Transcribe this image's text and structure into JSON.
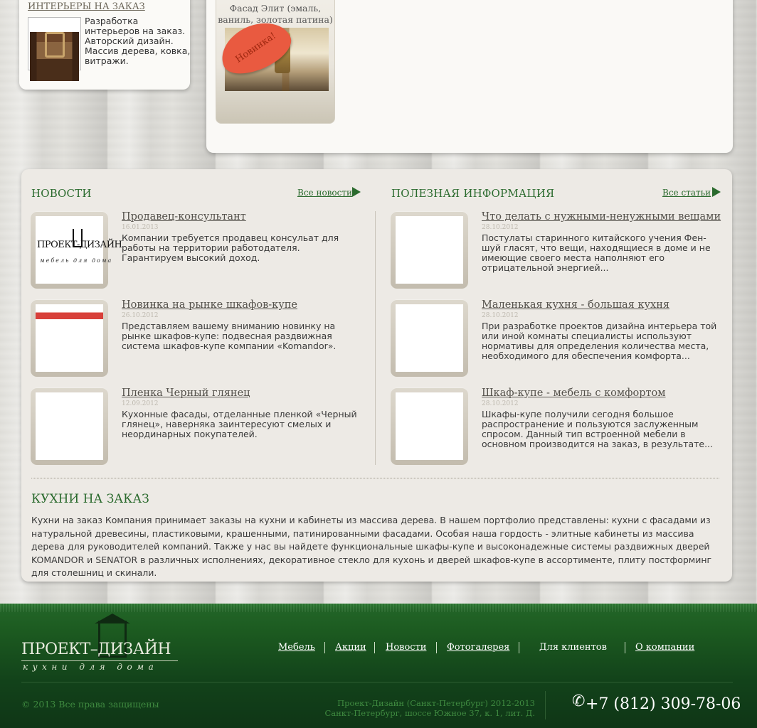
{
  "interiors_card": {
    "title": "ИНТЕРЬЕРЫ НА ЗАКАЗ",
    "description": "Разработка интерьеров на заказ. Авторский дизайн. Массив дерева, ковка, витражи."
  },
  "featured_product": {
    "name_line1": "Фасад Элит (эмаль,",
    "name_line2": "ваниль, золотая патина)",
    "badge": "Новинка!"
  },
  "news": {
    "title": "НОВОСТИ",
    "all_link": "Все новости",
    "items": [
      {
        "title": "Продавец-консультант",
        "date": "16.01.2013",
        "text": "Компании требуется продавец консульат для работы на территории работодателя. Гарантируем высокий доход.",
        "thumb_text": "ПРОЕКТ-ДИЗАЙН",
        "thumb_sub": "мебель для дома"
      },
      {
        "title": "Новинка на рынке шкафов-купе",
        "date": "26.10.2012",
        "text": "Представляем вашему вниманию новинку на рынке шкафов-купе: подвесная раздвижная система шкафов-купе компании «Komandor»."
      },
      {
        "title": "Пленка Черный глянец",
        "date": "12.09.2012",
        "text": "Кухонные фасады, отделанные пленкой «Черный глянец», наверняка заинтересуют смелых и неординарных покупателей."
      }
    ]
  },
  "articles": {
    "title": "ПОЛЕЗНАЯ ИНФОРМАЦИЯ",
    "all_link": "Все статьи",
    "items": [
      {
        "title": "Что делать с нужными-ненужными вещами",
        "date": "28.10.2012",
        "text": "Постулаты старинного китайского учения Фен-шуй гласят, что вещи, находящиеся в доме и не имеющие своего места наполняют его отрицательной энергией..."
      },
      {
        "title": "Маленькая кухня - большая кухня",
        "date": "28.10.2012",
        "text": "При разработке проектов дизайна интерьера той или иной комнаты специалисты используют нормативы для определения количества места, необходимого для обеспечения комфорта..."
      },
      {
        "title": "Шкаф-купе - мебель с комфортом",
        "date": "28.10.2012",
        "text": "Шкафы-купе получили сегодня большое распространение и пользуются заслуженным спросом. Данный тип встроенной мебели в основном производится на заказ, в результате..."
      }
    ]
  },
  "about": {
    "title": "КУХНИ НА ЗАКАЗ",
    "text": "Кухни на заказ Компания принимает заказы на кухни и кабинеты из массива дерева. В нашем портфолио представлены: кухни с фасадами из натуральной древесины, пластиковыми, крашенными, патинированными фасадами. Особая наша гордость - элитные кабинеты из массива дерева для руководителей компаний. Также у нас вы найдете функциональные шкафы-купе и высоконадежные системы раздвижных дверей KOMANDOR и SENATOR в различных исполнениях, декоративное стекло для кухонь и дверей шкафов-купе в ассортименте, плиту постформинг для столешниц и скинали."
  },
  "footer": {
    "logo_main": "ПРОЕКТ–ДИЗАЙН",
    "logo_sub": "кухни для дома",
    "nav": [
      "Мебель",
      "Акции",
      "Новости",
      "Фотогалерея",
      "Для клиентов",
      "О компании"
    ],
    "copyright": "© 2013 Все права защищены",
    "company_line1": "Проект-Дизайн (Санкт-Петербург) 2012-2013",
    "company_line2": "Санкт-Петербург, шоссе Южное 37, к. 1, лит. Д.",
    "phone_icon": "phone-icon",
    "phone": "+7 (812) 309-78-06"
  },
  "colors": {
    "accent_green": "#2a6a2d",
    "footer_green": "#1c5a20",
    "badge_red": "#e95a40"
  }
}
